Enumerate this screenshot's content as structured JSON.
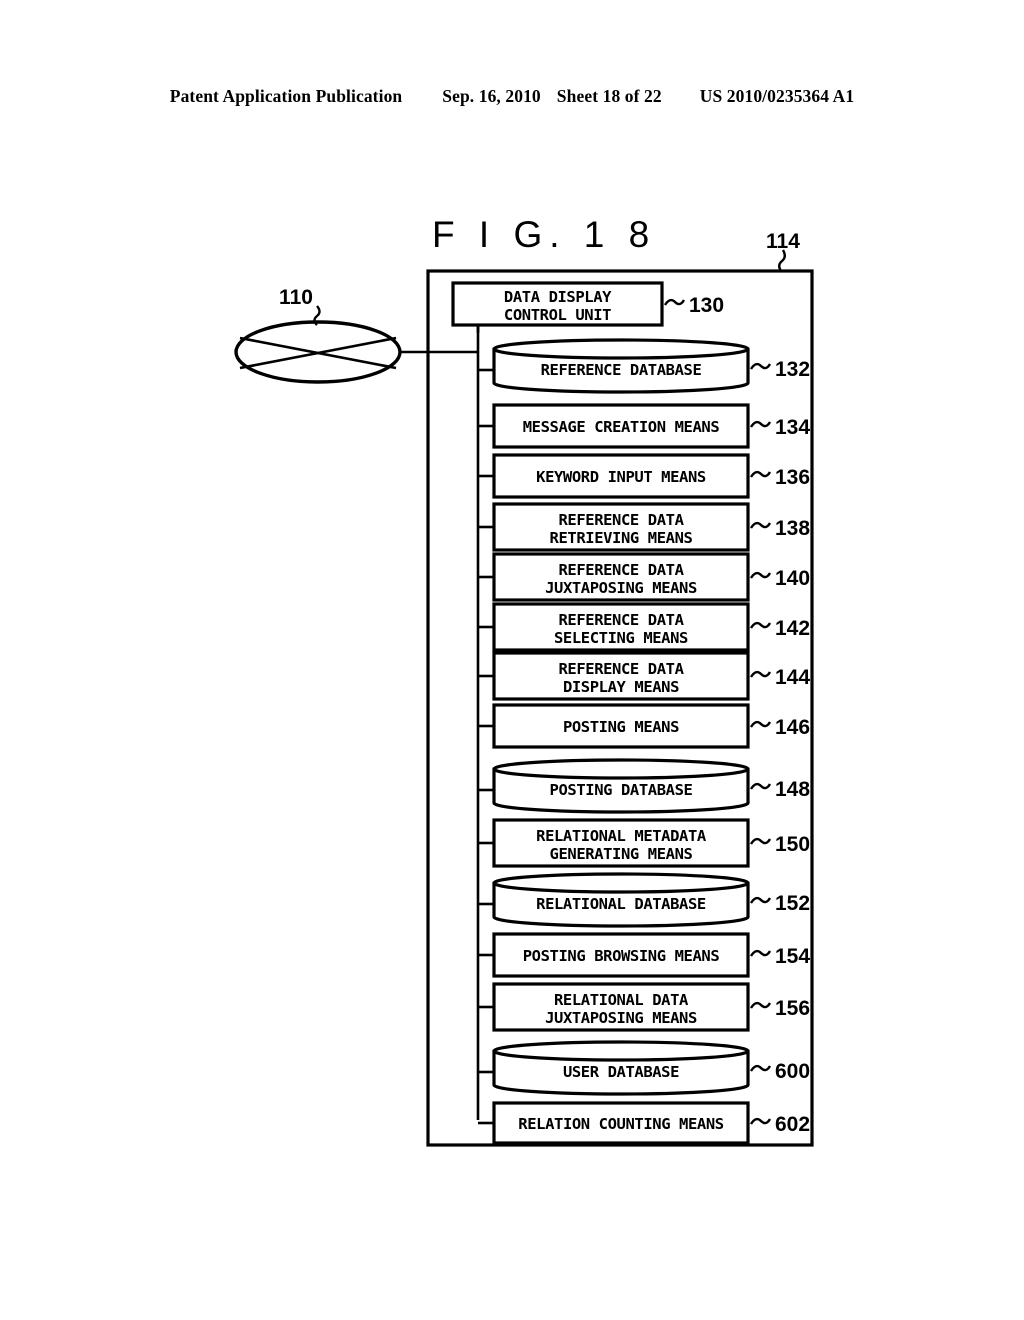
{
  "header": {
    "publication": "Patent Application Publication",
    "date": "Sep. 16, 2010",
    "sheet": "Sheet 18 of 22",
    "docnum": "US 2010/0235364 A1"
  },
  "figure": {
    "title": "F I G. 1 8",
    "network_symbol_ref": "110",
    "outer_frame_ref": "114"
  },
  "blocks": [
    {
      "ref": "130",
      "shape": "rect",
      "line1": "DATA DISPLAY",
      "line2": "CONTROL UNIT"
    },
    {
      "ref": "132",
      "shape": "cylinder",
      "line1": "REFERENCE DATABASE",
      "line2": ""
    },
    {
      "ref": "134",
      "shape": "rect",
      "line1": "MESSAGE CREATION MEANS",
      "line2": ""
    },
    {
      "ref": "136",
      "shape": "rect",
      "line1": "KEYWORD INPUT MEANS",
      "line2": ""
    },
    {
      "ref": "138",
      "shape": "rect",
      "line1": "REFERENCE DATA",
      "line2": "RETRIEVING MEANS"
    },
    {
      "ref": "140",
      "shape": "rect",
      "line1": "REFERENCE DATA",
      "line2": "JUXTAPOSING MEANS"
    },
    {
      "ref": "142",
      "shape": "rect",
      "line1": "REFERENCE DATA",
      "line2": "SELECTING MEANS"
    },
    {
      "ref": "144",
      "shape": "rect",
      "line1": "REFERENCE DATA",
      "line2": "DISPLAY MEANS"
    },
    {
      "ref": "146",
      "shape": "rect",
      "line1": "POSTING MEANS",
      "line2": ""
    },
    {
      "ref": "148",
      "shape": "cylinder",
      "line1": "POSTING DATABASE",
      "line2": ""
    },
    {
      "ref": "150",
      "shape": "rect",
      "line1": "RELATIONAL METADATA",
      "line2": "GENERATING MEANS"
    },
    {
      "ref": "152",
      "shape": "cylinder",
      "line1": "RELATIONAL DATABASE",
      "line2": ""
    },
    {
      "ref": "154",
      "shape": "rect",
      "line1": "POSTING BROWSING MEANS",
      "line2": ""
    },
    {
      "ref": "156",
      "shape": "rect",
      "line1": "RELATIONAL DATA",
      "line2": "JUXTAPOSING MEANS"
    },
    {
      "ref": "600",
      "shape": "cylinder",
      "line1": "USER DATABASE",
      "line2": ""
    },
    {
      "ref": "602",
      "shape": "rect",
      "line1": "RELATION COUNTING MEANS",
      "line2": ""
    }
  ],
  "colors": {
    "ink": "#000000",
    "paper": "#ffffff"
  }
}
